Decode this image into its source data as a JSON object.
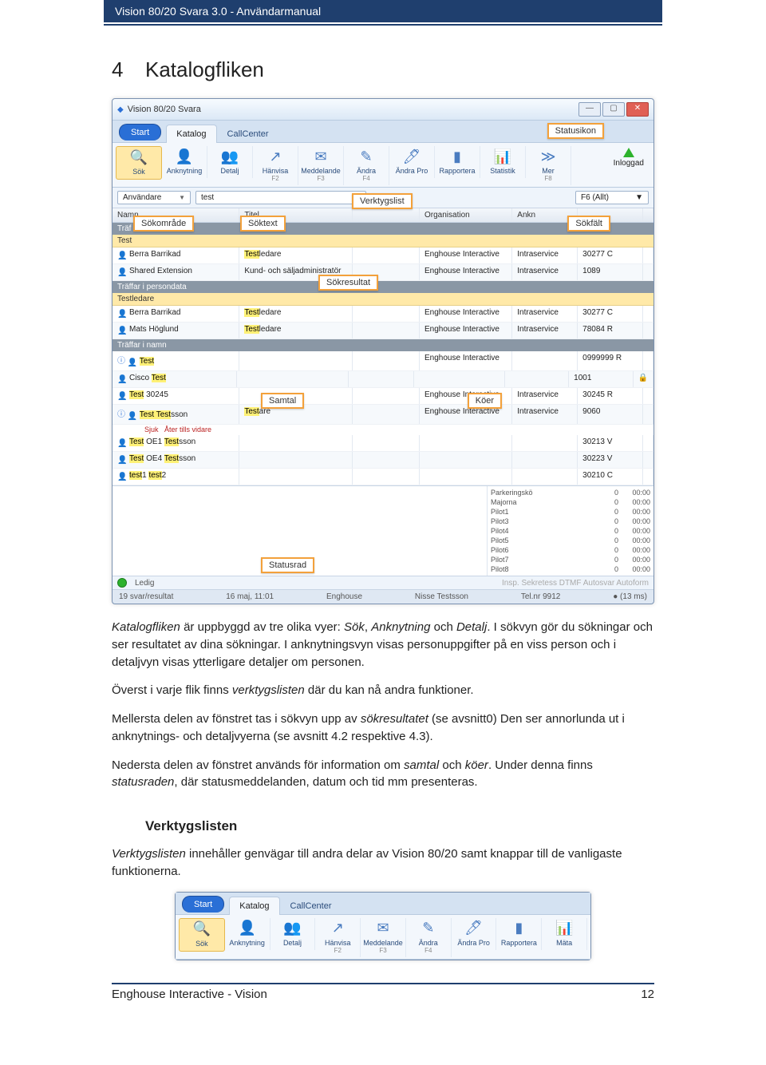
{
  "doc": {
    "header": "Vision 80/20 Svara 3.0 - Användarmanual",
    "footer_left": "Enghouse Interactive - Vision",
    "footer_right": "12",
    "section_num": "4",
    "section_title": "Katalogfliken",
    "p1_a": "Katalogfliken",
    "p1_b": " är uppbyggd av tre olika vyer: ",
    "p1_c": "Sök",
    "p1_d": ", ",
    "p1_e": "Anknytning",
    "p1_f": " och ",
    "p1_g": "Detalj",
    "p1_h": ". I sökvyn gör du sökningar och ser resultatet av dina sökningar. I anknytningsvyn visas personuppgifter på en viss person och i detaljvyn visas ytterligare detaljer om personen.",
    "p2_a": "Överst i varje flik finns ",
    "p2_b": "verktygslisten",
    "p2_c": " där du kan nå andra funktioner.",
    "p3_a": "Mellersta delen av fönstret tas i sökvyn upp av ",
    "p3_b": "sökresultatet",
    "p3_c": " (se avsnitt0) Den ser annorlunda ut i anknytnings- och detaljvyerna (se avsnitt 4.2 respektive 4.3).",
    "p4_a": "Nedersta delen av fönstret används för information om ",
    "p4_b": "samtal",
    "p4_c": " och ",
    "p4_d": "köer",
    "p4_e": ". Under denna finns ",
    "p4_f": "statusraden",
    "p4_g": ", där statusmeddelanden, datum och tid mm presenteras.",
    "subsection": "Verktygslisten",
    "p5_a": "Verktygslisten",
    "p5_b": " innehåller genvägar till andra delar av Vision 80/20 samt knappar till de vanligaste funktionerna."
  },
  "app": {
    "title": "Vision 80/20 Svara",
    "start": "Start",
    "tabs": {
      "katalog": "Katalog",
      "callcenter": "CallCenter"
    },
    "toolbar": {
      "sok": "Sök",
      "anknytning": "Anknytning",
      "detalj": "Detalj",
      "hanvisa": "Hänvisa",
      "hanvisa_hk": "F2",
      "meddelande": "Meddelande",
      "meddelande_hk": "F3",
      "andra": "Ändra",
      "andra_hk": "F4",
      "andrapro": "Ändra Pro",
      "rapportera": "Rapportera",
      "statistik": "Statistik",
      "mer": "Mer",
      "mer_hk": "F8",
      "mata": "Mäta",
      "inloggad": "Inloggad"
    },
    "search": {
      "dropdown": "Användare",
      "value": "test",
      "f6": "F6 (Allt)"
    },
    "cols": {
      "namn": "Namn",
      "titel": "Titel",
      "org": "Organisation",
      "ankn": "Ankn"
    },
    "sections": {
      "traf": "Träf",
      "test": "Test",
      "persondata": "Träffar i persondata",
      "testledare": "Testledare",
      "namn": "Träffar i namn"
    },
    "rows": {
      "r1_name": "Berra Barrikad",
      "r1_title_pre": "Test",
      "r1_title_post": "ledare",
      "r1_org": "Enghouse Interactive",
      "r1_ank": "Intraservice",
      "r1_num": "30277 C",
      "r2_name": "Shared Extension",
      "r2_title": "Kund- och säljadministratör",
      "r2_org": "Enghouse Interactive",
      "r2_ank": "Intraservice",
      "r2_num": "1089",
      "r3_name": "Berra Barrikad",
      "r3_title_pre": "Test",
      "r3_title_post": "ledare",
      "r3_org": "Enghouse Interactive",
      "r3_ank": "Intraservice",
      "r3_num": "30277 C",
      "r4_name": "Mats Höglund",
      "r4_title_pre": "Test",
      "r4_title_post": "ledare",
      "r4_org": "Enghouse Interactive",
      "r4_ank": "Intraservice",
      "r4_num": "78084 R",
      "r5_name": "Test",
      "r5_org": "Enghouse Interactive",
      "r5_num": "0999999 R",
      "r6_pre": "Cisco ",
      "r6_name": "Test",
      "r6_num": "1001",
      "r7_name": "Test",
      "r7_post": " 30245",
      "r7_org": "Enghouse Interactive",
      "r7_ank": "Intraservice",
      "r7_num": "30245 R",
      "r8_name": "Test Test",
      "r8_post": "sson",
      "r8_title_pre": "Test",
      "r8_title_post": "are",
      "r8_org": "Enghouse Interactive",
      "r8_ank": "Intraservice",
      "r8_num": "9060",
      "sick_a": "Sjuk",
      "sick_b": "Åter tills vidare",
      "r9_name": "Test",
      "r9_mid": " OE1 ",
      "r9_name2": "Test",
      "r9_post": "sson",
      "r9_num": "30213 V",
      "r10_name": "Test",
      "r10_mid": " OE4 ",
      "r10_name2": "Test",
      "r10_post": "sson",
      "r10_num": "30223 V",
      "r11_name": "test",
      "r11_mid": "1 ",
      "r11_name2": "test",
      "r11_post": "2",
      "r11_num": "30210 C"
    },
    "queues": [
      {
        "n": "Parkeringskö",
        "c": "0",
        "t": "00:00"
      },
      {
        "n": "Majorna",
        "c": "0",
        "t": "00:00"
      },
      {
        "n": "Pilot1",
        "c": "0",
        "t": "00:00"
      },
      {
        "n": "Pilot3",
        "c": "0",
        "t": "00:00"
      },
      {
        "n": "Pilot4",
        "c": "0",
        "t": "00:00"
      },
      {
        "n": "Pilot5",
        "c": "0",
        "t": "00:00"
      },
      {
        "n": "Pilot6",
        "c": "0",
        "t": "00:00"
      },
      {
        "n": "Pilot7",
        "c": "0",
        "t": "00:00"
      },
      {
        "n": "Pilot8",
        "c": "0",
        "t": "00:00"
      }
    ],
    "statusstrip": {
      "ledig": "Ledig",
      "insp": "Insp. Sekretess DTMF Autosvar Autoform"
    },
    "statusbar": {
      "left": "19 svar/resultat",
      "date": "16 maj, 11:01",
      "co": "Enghouse",
      "user": "Nisse Testsson",
      "tel": "Tel.nr 9912",
      "ping": "(13 ms)"
    }
  },
  "callouts": {
    "statusikon": "Statusikon",
    "verktygslist": "Verktygslist",
    "sokomrade": "Sökområde",
    "soktext": "Söktext",
    "sokfalt": "Sökfält",
    "sokresultat": "Sökresultat",
    "samtal": "Samtal",
    "koer": "Köer",
    "statusrad": "Statusrad"
  }
}
